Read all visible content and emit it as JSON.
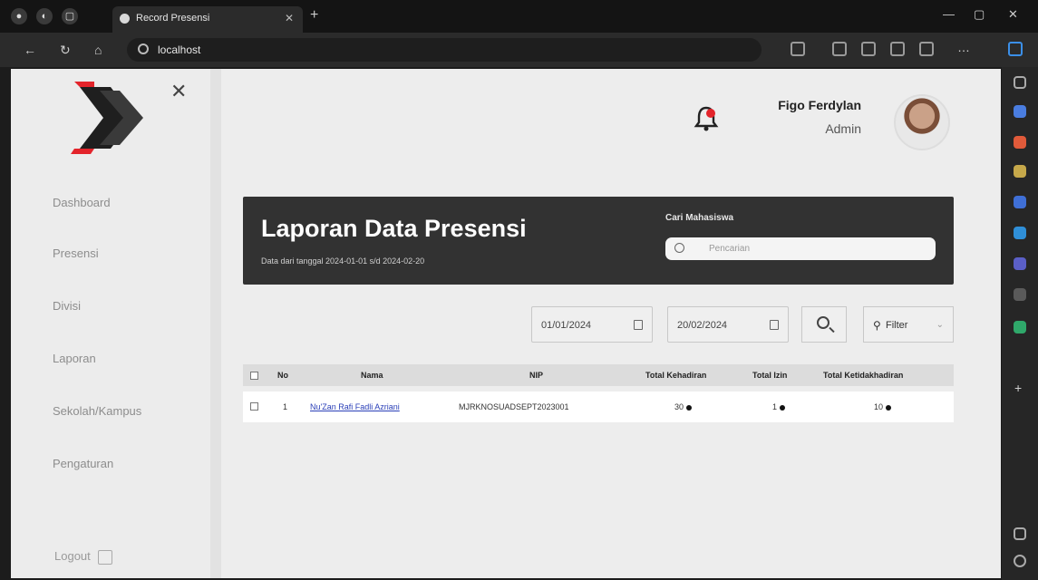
{
  "browser": {
    "tab_title": "Record Presensi",
    "url_host": "localhost",
    "url_path": ""
  },
  "sidebar": {
    "items": [
      {
        "label": "Dashboard"
      },
      {
        "label": "Presensi"
      },
      {
        "label": "Divisi"
      },
      {
        "label": "Laporan"
      },
      {
        "label": "Sekolah/Kampus"
      },
      {
        "label": "Pengaturan"
      }
    ],
    "logout_label": "Logout"
  },
  "header": {
    "user_name": "Figo Ferdylan",
    "user_role": "Admin"
  },
  "banner": {
    "title": "Laporan Data Presensi",
    "subtitle": "Data dari tanggal 2024-01-01 s/d 2024-02-20",
    "search_label": "Cari Mahasiswa",
    "search_placeholder": "Pencarian"
  },
  "filters": {
    "start_date": "01/01/2024",
    "end_date": "20/02/2024",
    "filter_label": "Filter"
  },
  "table": {
    "columns": [
      "No",
      "Nama",
      "NIP",
      "Total Kehadiran",
      "Total Izin",
      "Total Ketidakhadiran"
    ],
    "rows": [
      {
        "no": "1",
        "name": "Nu'Zan Rafi Fadli Azriani",
        "nip": "MJRKNOSUADSEPT2023001",
        "hadir": "30",
        "izin": "1",
        "absen": "10"
      }
    ]
  },
  "colors": {
    "banner_bg": "#323232",
    "accent_red": "#e3242b",
    "link": "#2a3fb8"
  }
}
